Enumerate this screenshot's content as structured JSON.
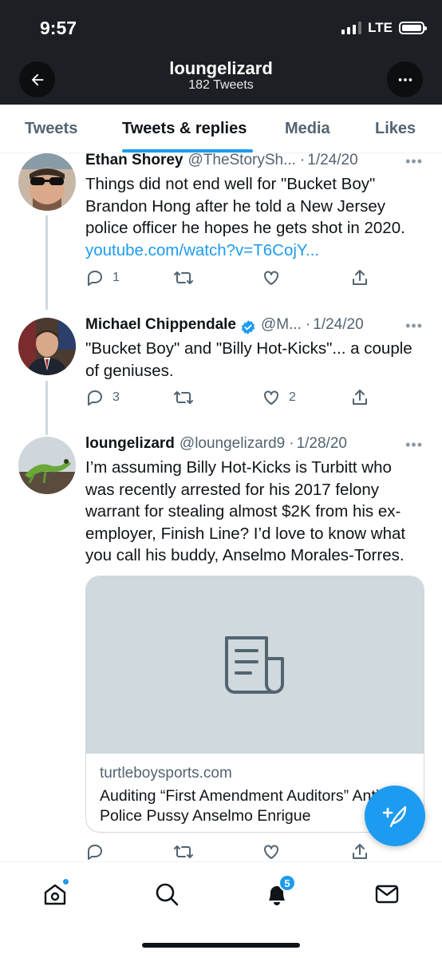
{
  "status_bar": {
    "time": "9:57",
    "network": "LTE"
  },
  "header": {
    "title": "loungelizard",
    "subtitle": "182 Tweets"
  },
  "tabs": [
    {
      "label": "Tweets",
      "active": false
    },
    {
      "label": "Tweets & replies",
      "active": true
    },
    {
      "label": "Media",
      "active": false
    },
    {
      "label": "Likes",
      "active": false
    }
  ],
  "tweets": [
    {
      "name": "Ethan Shorey",
      "handle": "@TheStorySh...",
      "dot": "·",
      "date": "1/24/20",
      "text": "Things did not end well for \"Bucket Boy\" Brandon Hong after he told a New Jersey police officer he hopes he gets shot in 2020.",
      "link": "youtube.com/watch?v=T6CojY...",
      "replies": "1",
      "retweets": "",
      "likes": ""
    },
    {
      "name": "Michael Chippendale",
      "handle": "@M...",
      "dot": "·",
      "date": "1/24/20",
      "text": "\"Bucket Boy\" and \"Billy Hot-Kicks\"... a couple of geniuses.",
      "replies": "3",
      "retweets": "",
      "likes": "2"
    },
    {
      "name": "loungelizard",
      "handle": "@loungelizard9",
      "dot": "·",
      "date": "1/28/20",
      "text": "I’m assuming Billy Hot-Kicks is Turbitt who was recently arrested for his 2017 felony warrant for stealing almost $2K from his ex-employer, Finish Line? I’d love to know what you call his buddy, Anselmo Morales-Torres.",
      "card_domain": "turtleboysports.com",
      "card_title": "Auditing “First Amendment Auditors” Anti-Police Pussy Anselmo Enrigue"
    }
  ],
  "bottom_nav": {
    "notifications_badge": "5"
  },
  "colors": {
    "accent": "#1d9bf0",
    "header_bg": "#1c1f23",
    "secondary_text": "#536471"
  },
  "icons": [
    "back-arrow-icon",
    "more-icon",
    "reply-icon",
    "retweet-icon",
    "like-icon",
    "share-icon",
    "verified-icon",
    "document-icon",
    "compose-icon",
    "home-icon",
    "search-icon",
    "bell-icon",
    "mail-icon"
  ]
}
